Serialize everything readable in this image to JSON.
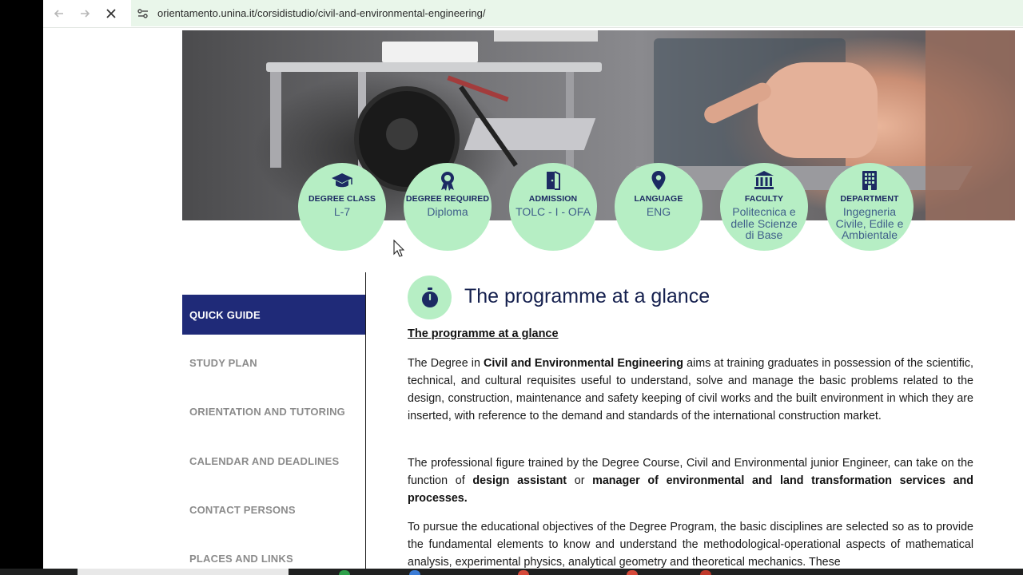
{
  "browser": {
    "url": "orientamento.unina.it/corsidistudio/civil-and-environmental-engineering/"
  },
  "colors": {
    "circle": "#b6eec4",
    "sidebar_active": "#1f2a78",
    "heading": "#16214f"
  },
  "info_circles": [
    {
      "icon": "graduation-cap-icon",
      "title": "DEGREE CLASS",
      "value": "L-7"
    },
    {
      "icon": "award-ribbon-icon",
      "title": "DEGREE REQUIRED",
      "value": "Diploma"
    },
    {
      "icon": "door-open-icon",
      "title": "ADMISSION",
      "value": "TOLC - I - OFA"
    },
    {
      "icon": "map-pin-icon",
      "title": "LANGUAGE",
      "value": "ENG"
    },
    {
      "icon": "institution-building-icon",
      "title": "FACULTY",
      "value": "Politecnica e delle Scienze di Base"
    },
    {
      "icon": "office-building-icon",
      "title": "DEPARTMENT",
      "value": "Ingegneria Civile, Edile e Ambientale"
    }
  ],
  "sidebar": {
    "items": [
      {
        "label": "QUICK GUIDE",
        "active": true
      },
      {
        "label": "STUDY PLAN"
      },
      {
        "label": "ORIENTATION AND TUTORING"
      },
      {
        "label": "CALENDAR AND DEADLINES"
      },
      {
        "label": "CONTACT PERSONS"
      },
      {
        "label": "PLACES AND LINKS"
      }
    ]
  },
  "content": {
    "title": "The programme at a glance",
    "subtitle": "The programme at a glance",
    "p1_a": "The Degree in ",
    "p1_b": "Civil and Environmental Engineering",
    "p1_c": " aims at training graduates in possession of the scientific, technical, and cultural requisites useful to understand, solve and manage the basic problems related to the design, construction, maintenance and safety keeping of civil works and the built environment in which they are inserted, with reference to the demand and standards of the international construction market.",
    "p2_a": "The professional figure trained by the Degree Course, Civil and Environmental junior Engineer, can take on the function of ",
    "p2_b": "design assistant",
    "p2_c": " or ",
    "p2_d": "manager of environmental and land transformation services and processes.",
    "p3": "To pursue the educational objectives of the Degree Program, the basic disciplines are selected so as to provide the fundamental elements to know and understand the methodological-operational aspects of mathematical analysis, experimental physics, analytical geometry and theoretical mechanics. These"
  }
}
